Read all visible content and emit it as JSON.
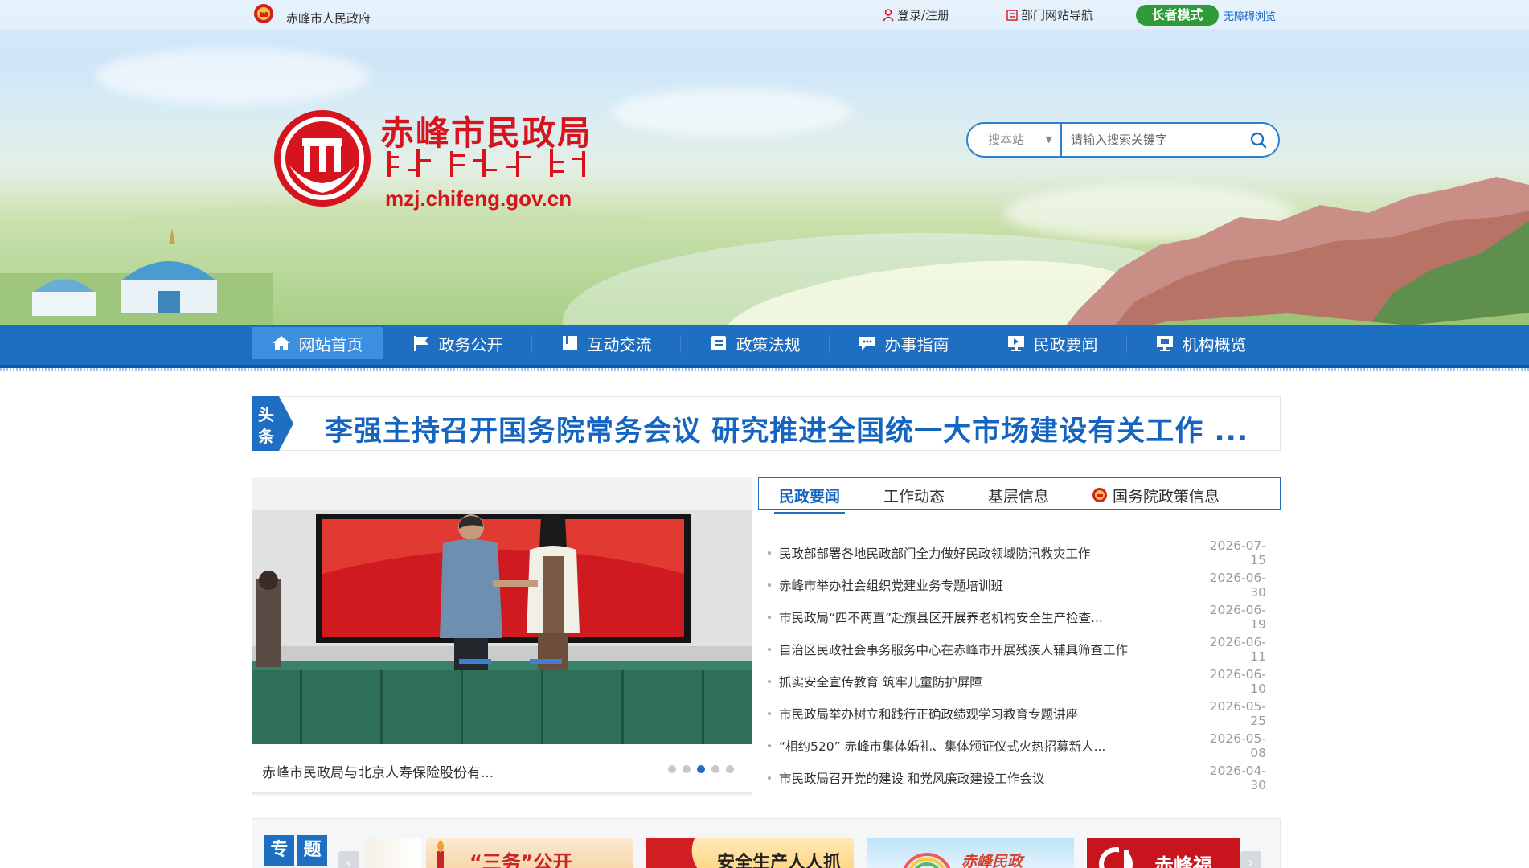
{
  "topbar": {
    "gov_name": "赤峰市人民政府",
    "login": "登录/注册",
    "dept_nav": "部门网站导航",
    "elder_mode": "长者模式",
    "accessibility": "无障碍浏览"
  },
  "brand": {
    "title": "赤峰市民政局",
    "url": "mzj.chifeng.gov.cn",
    "color": "#d7141d"
  },
  "search": {
    "scope": "搜本站",
    "placeholder": "请输入搜索关键字"
  },
  "nav": {
    "items": [
      {
        "label": "网站首页",
        "icon": "home-icon"
      },
      {
        "label": "政务公开",
        "icon": "flag-icon"
      },
      {
        "label": "互动交流",
        "icon": "book-icon"
      },
      {
        "label": "政策法规",
        "icon": "document-icon"
      },
      {
        "label": "办事指南",
        "icon": "chat-icon"
      },
      {
        "label": "民政要闻",
        "icon": "monitor-icon"
      },
      {
        "label": "机构概览",
        "icon": "monitor-icon"
      }
    ],
    "accent": "#1e6fc1"
  },
  "headline": {
    "tag_top": "头",
    "tag_bottom": "条",
    "text": "李强主持召开国务院常务会议 研究推进全国统一大市场建设有关工作 ..."
  },
  "carousel": {
    "caption": "赤峰市民政局与北京人寿保险股份有...",
    "dots": 5,
    "active_dot": 3
  },
  "news": {
    "tabs": [
      "民政要闻",
      "工作动态",
      "基层信息",
      "国务院政策信息"
    ],
    "active_tab": 0,
    "items": [
      {
        "title": "民政部部署各地民政部门全力做好民政领域防汛救灾工作",
        "date": "2026-07-15"
      },
      {
        "title": "赤峰市举办社会组织党建业务专题培训班",
        "date": "2026-06-30"
      },
      {
        "title": "市民政局“四不两直”赴旗县区开展养老机构安全生产检查...",
        "date": "2026-06-19"
      },
      {
        "title": "自治区民政社会事务服务中心在赤峰市开展残疾人辅具筛查工作",
        "date": "2026-06-11"
      },
      {
        "title": "抓实安全宣传教育 筑牢儿童防护屏障",
        "date": "2026-06-10"
      },
      {
        "title": "市民政局举办树立和践行正确政绩观学习教育专题讲座",
        "date": "2026-05-25"
      },
      {
        "title": "“相约520” 赤峰市集体婚礼、集体颁证仪式火热招募新人...",
        "date": "2026-05-08"
      },
      {
        "title": "市民政局召开党的建设 和党风廉政建设工作会议",
        "date": "2026-04-30"
      }
    ]
  },
  "topics": {
    "badge_1": "专",
    "badge_2": "题",
    "cards": [
      {
        "label": "“三务”公开"
      },
      {
        "label": "安全生产人人抓"
      },
      {
        "label": "赤峰民政"
      },
      {
        "label": "赤峰福"
      }
    ]
  }
}
